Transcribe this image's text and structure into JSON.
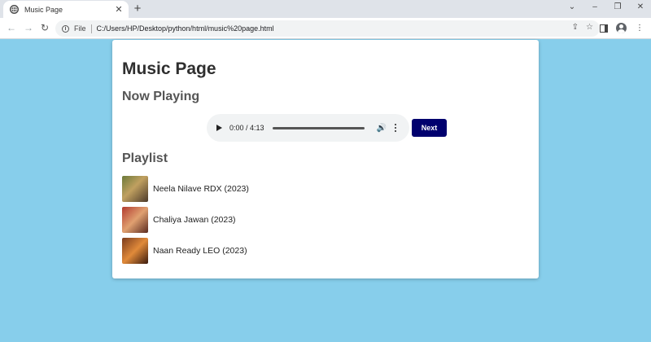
{
  "browser": {
    "tab_title": "Music Page",
    "new_tab_symbol": "+",
    "file_label": "File",
    "url": "C:/Users/HP/Desktop/python/html/music%20page.html"
  },
  "page": {
    "title": "Music Page",
    "now_playing_heading": "Now Playing",
    "player": {
      "time": "0:00 / 4:13",
      "progress_percent": 0
    },
    "next_label": "Next",
    "playlist_heading": "Playlist",
    "playlist": [
      {
        "label": "Neela Nilave RDX (2023)"
      },
      {
        "label": "Chaliya Jawan (2023)"
      },
      {
        "label": "Naan Ready LEO (2023)"
      }
    ]
  },
  "colors": {
    "page_background": "#87ceeb",
    "card_background": "#ffffff",
    "next_button": "#00006e"
  },
  "icons": [
    "globe-icon",
    "close-icon",
    "back-icon",
    "forward-icon",
    "reload-icon",
    "info-icon",
    "share-icon",
    "star-icon",
    "side-panel-icon",
    "profile-icon",
    "kebab-menu-icon",
    "play-icon",
    "volume-icon",
    "more-options-icon"
  ]
}
